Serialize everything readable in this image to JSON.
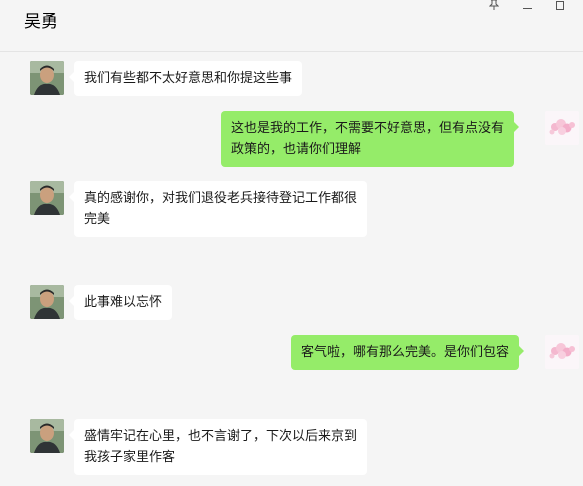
{
  "header": {
    "title": "吴勇",
    "controls": [
      "pin-icon",
      "minimize-icon",
      "maximize-icon"
    ]
  },
  "colors": {
    "background": "#f5f5f5",
    "bubble_incoming": "#ffffff",
    "bubble_outgoing": "#95ec69"
  },
  "messages": [
    {
      "from": "contact",
      "text": "我们有些都不太好意思和你提这些事"
    },
    {
      "from": "me",
      "text": "这也是我的工作，不需要不好意思，但有点没有\n政策的，也请你们理解"
    },
    {
      "from": "contact",
      "text": "真的感谢你，对我们退役老兵接待登记工作都很\n完美"
    },
    {
      "from": "contact",
      "text": "此事难以忘怀"
    },
    {
      "from": "me",
      "text": "客气啦，哪有那么完美。是你们包容"
    },
    {
      "from": "contact",
      "text": "盛情牢记在心里，也不言谢了，下次以后来京到\n我孩子家里作客"
    }
  ]
}
